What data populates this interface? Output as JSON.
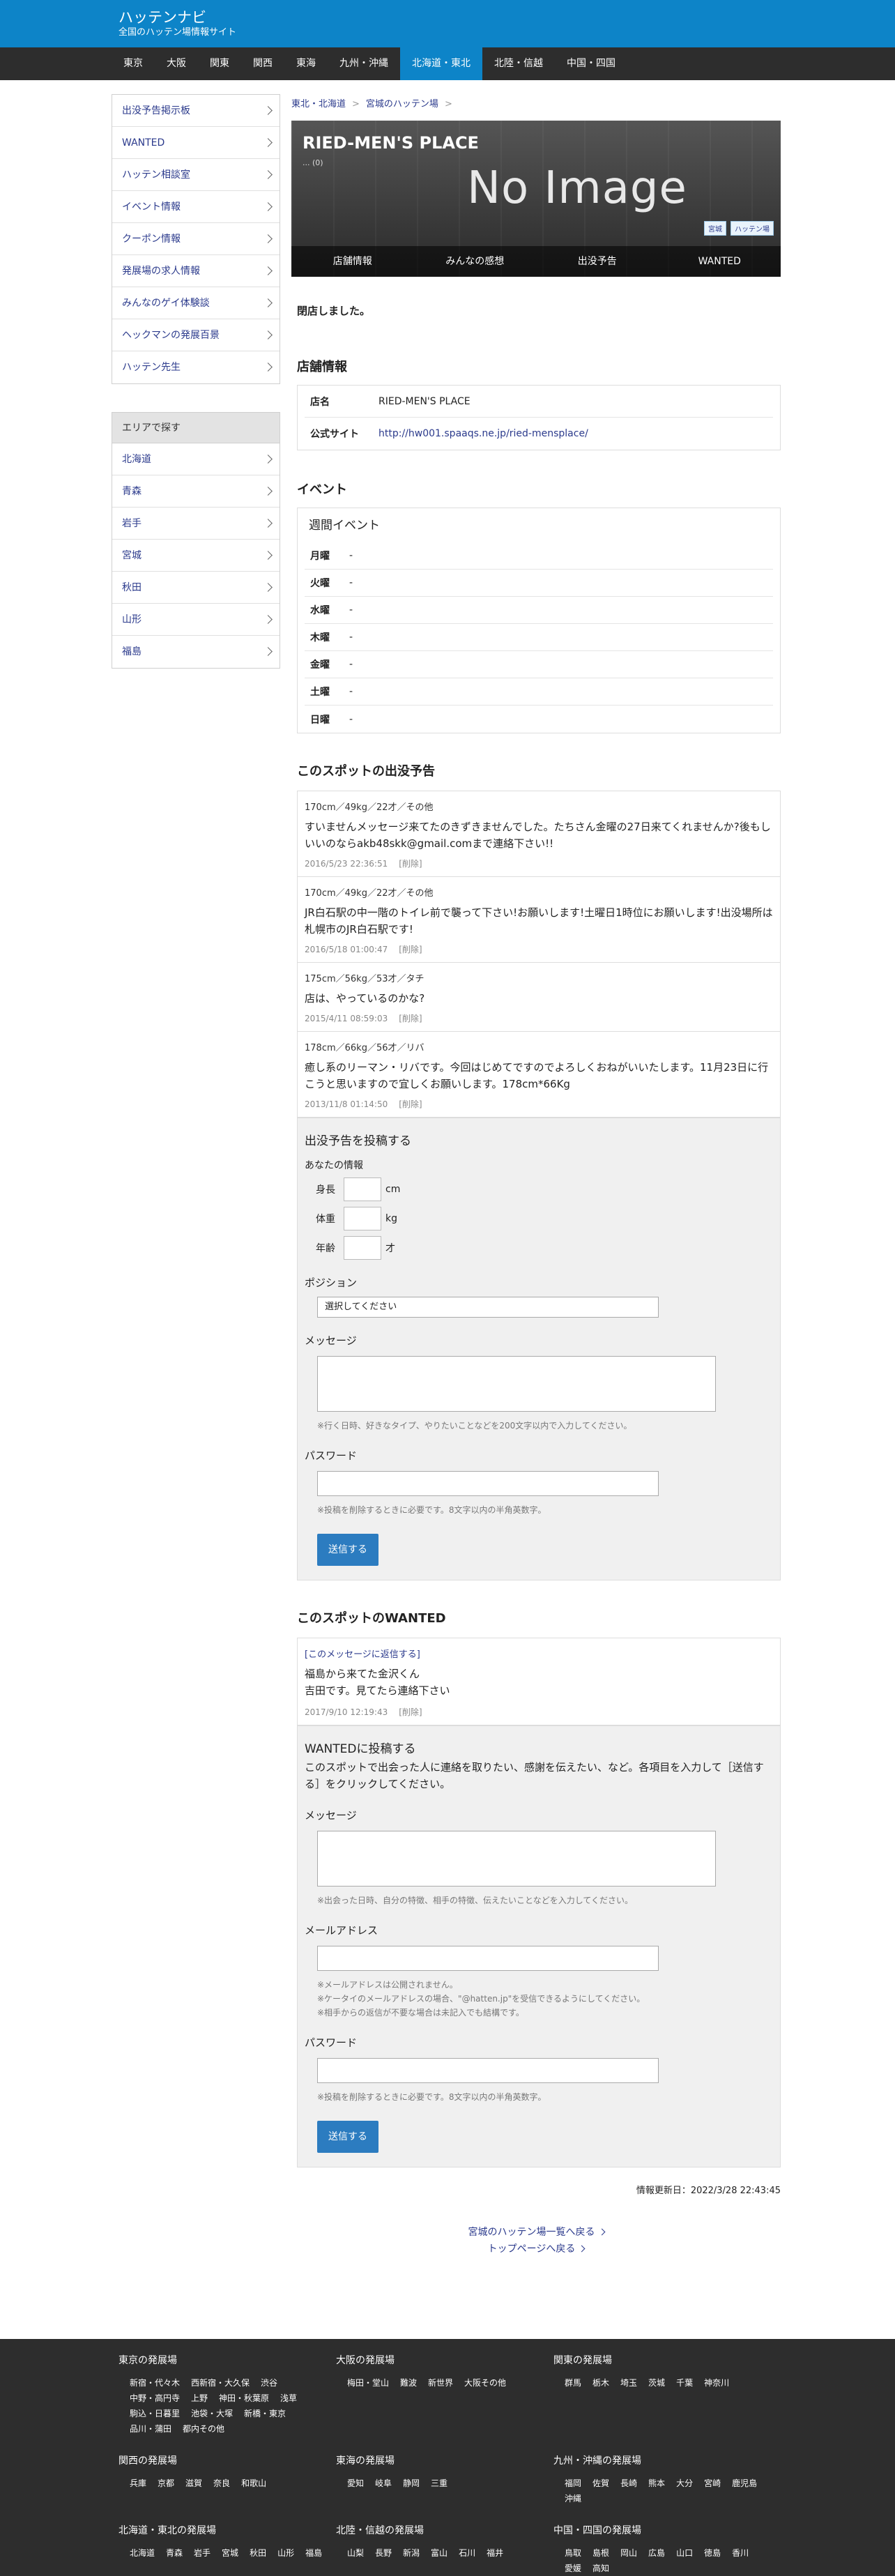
{
  "site": {
    "title": "ハッテンナビ",
    "subtitle": "全国のハッテン場情報サイト"
  },
  "nav": [
    "東京",
    "大阪",
    "関東",
    "関西",
    "東海",
    "九州・沖縄",
    "北海道・東北",
    "北陸・信越",
    "中国・四国"
  ],
  "nav_active": "北海道・東北",
  "sidebar": {
    "menu": [
      "出没予告掲示板",
      "WANTED",
      "ハッテン相談室",
      "イベント情報",
      "クーポン情報",
      "発展場の求人情報",
      "みんなのゲイ体験談",
      "ヘックマンの発展百景",
      "ハッテン先生"
    ],
    "area_title": "エリアで探す",
    "areas": [
      "北海道",
      "青森",
      "岩手",
      "宮城",
      "秋田",
      "山形",
      "福島"
    ]
  },
  "breadcrumb": [
    "東北・北海道",
    "宮城のハッテン場"
  ],
  "hero": {
    "name": "RIED-MEN'S PLACE",
    "count": "... (0)",
    "noimage": "No Image",
    "tags": [
      "宮城",
      "ハッテン場"
    ],
    "tabs": [
      "店舗情報",
      "みんなの感想",
      "出没予告",
      "WANTED"
    ]
  },
  "closed_msg": "閉店しました。",
  "info": {
    "heading": "店舗情報",
    "rows": [
      {
        "k": "店名",
        "v": "RIED-MEN'S PLACE"
      },
      {
        "k": "公式サイト",
        "v": "http://hw001.spaaqs.ne.jp/ried-mensplace/"
      }
    ]
  },
  "event": {
    "heading": "イベント",
    "week_title": "週間イベント",
    "rows": [
      {
        "k": "月曜",
        "v": "-"
      },
      {
        "k": "火曜",
        "v": "-"
      },
      {
        "k": "水曜",
        "v": "-"
      },
      {
        "k": "木曜",
        "v": "-"
      },
      {
        "k": "金曜",
        "v": "-"
      },
      {
        "k": "土曜",
        "v": "-"
      },
      {
        "k": "日曜",
        "v": "-"
      }
    ]
  },
  "posts": {
    "heading": "このスポットの出没予告",
    "items": [
      {
        "meta": "170cm／49kg／22才／その他",
        "body": "すいませんメッセージ来てたのきずきませんでした。たちさん金曜の27日来てくれませんか?後もしいいのならakb48skk@gmail.comまで連絡下さい!!",
        "date": "2016/5/23 22:36:51",
        "del": "[削除]"
      },
      {
        "meta": "170cm／49kg／22才／その他",
        "body": "JR白石駅の中一階のトイレ前で襲って下さい!お願いします!土曜日1時位にお願いします!出没場所は札幌市のJR白石駅です!",
        "date": "2016/5/18 01:00:47",
        "del": "[削除]"
      },
      {
        "meta": "175cm／56kg／53才／タチ",
        "body": "店は、やっているのかな?",
        "date": "2015/4/11 08:59:03",
        "del": "[削除]"
      },
      {
        "meta": "178cm／66kg／56才／リバ",
        "body": "癒し系のリーマン・リバです。今回はじめてですのでよろしくおねがいいたします。11月23日に行こうと思いますので宜しくお願いします。178cm*66Kg",
        "date": "2013/11/8 01:14:50",
        "del": "[削除]"
      }
    ]
  },
  "post_form": {
    "heading": "出没予告を投稿する",
    "you_label": "あなたの情報",
    "height_label": "身長",
    "height_unit": "cm",
    "weight_label": "体重",
    "weight_unit": "kg",
    "age_label": "年齢",
    "age_unit": "才",
    "position_label": "ポジション",
    "position_value": "選択してください",
    "message_label": "メッセージ",
    "message_note": "※行く日時、好きなタイプ、やりたいことなどを200文字以内で入力してください。",
    "password_label": "パスワード",
    "password_note": "※投稿を削除するときに必要です。8文字以内の半角英数字。",
    "submit": "送信する"
  },
  "wanted": {
    "heading": "このスポットのWANTED",
    "item": {
      "reply": "[このメッセージに返信する]",
      "body1": "福島から来てた金沢くん",
      "body2": "吉田です。見てたら連絡下さい",
      "date": "2017/9/10 12:19:43",
      "del": "[削除]"
    }
  },
  "wanted_form": {
    "heading": "WANTEDに投稿する",
    "intro": "このスポットで出会った人に連絡を取りたい、感謝を伝えたい、など。各項目を入力して［送信する］をクリックしてください。",
    "message_label": "メッセージ",
    "message_note": "※出会った日時、自分の特徴、相手の特徴、伝えたいことなどを入力してください。",
    "email_label": "メールアドレス",
    "email_notes": [
      "※メールアドレスは公開されません。",
      "※ケータイのメールアドレスの場合、\"@hatten.jp\"を受信できるようにしてください。",
      "※相手からの返信が不要な場合は未記入でも結構です。"
    ],
    "password_label": "パスワード",
    "password_note": "※投稿を削除するときに必要です。8文字以内の半角英数字。",
    "submit": "送信する"
  },
  "updated": "情報更新日：2022/3/28 22:43:45",
  "back_links": [
    "宮城のハッテン場一覧へ戻る",
    "トップページへ戻る"
  ],
  "footer": [
    {
      "h": "東京の発展場",
      "links": [
        "新宿・代々木",
        "西新宿・大久保",
        "渋谷",
        "中野・高円寺",
        "上野",
        "神田・秋葉原",
        "浅草",
        "駒込・日暮里",
        "池袋・大塚",
        "新橋・東京",
        "品川・蒲田",
        "都内その他"
      ]
    },
    {
      "h": "大阪の発展場",
      "links": [
        "梅田・堂山",
        "難波",
        "新世界",
        "大阪その他"
      ]
    },
    {
      "h": "関東の発展場",
      "links": [
        "群馬",
        "栃木",
        "埼玉",
        "茨城",
        "千葉",
        "神奈川"
      ]
    },
    {
      "h": "関西の発展場",
      "links": [
        "兵庫",
        "京都",
        "滋賀",
        "奈良",
        "和歌山"
      ]
    },
    {
      "h": "東海の発展場",
      "links": [
        "愛知",
        "岐阜",
        "静岡",
        "三重"
      ]
    },
    {
      "h": "九州・沖縄の発展場",
      "links": [
        "福岡",
        "佐賀",
        "長崎",
        "熊本",
        "大分",
        "宮崎",
        "鹿児島",
        "沖縄"
      ]
    },
    {
      "h": "北海道・東北の発展場",
      "links": [
        "北海道",
        "青森",
        "岩手",
        "宮城",
        "秋田",
        "山形",
        "福島"
      ]
    },
    {
      "h": "北陸・信越の発展場",
      "links": [
        "山梨",
        "長野",
        "新潟",
        "富山",
        "石川",
        "福井"
      ]
    },
    {
      "h": "中国・四国の発展場",
      "links": [
        "鳥取",
        "島根",
        "岡山",
        "広島",
        "山口",
        "徳島",
        "香川",
        "愛媛",
        "高知"
      ]
    }
  ]
}
